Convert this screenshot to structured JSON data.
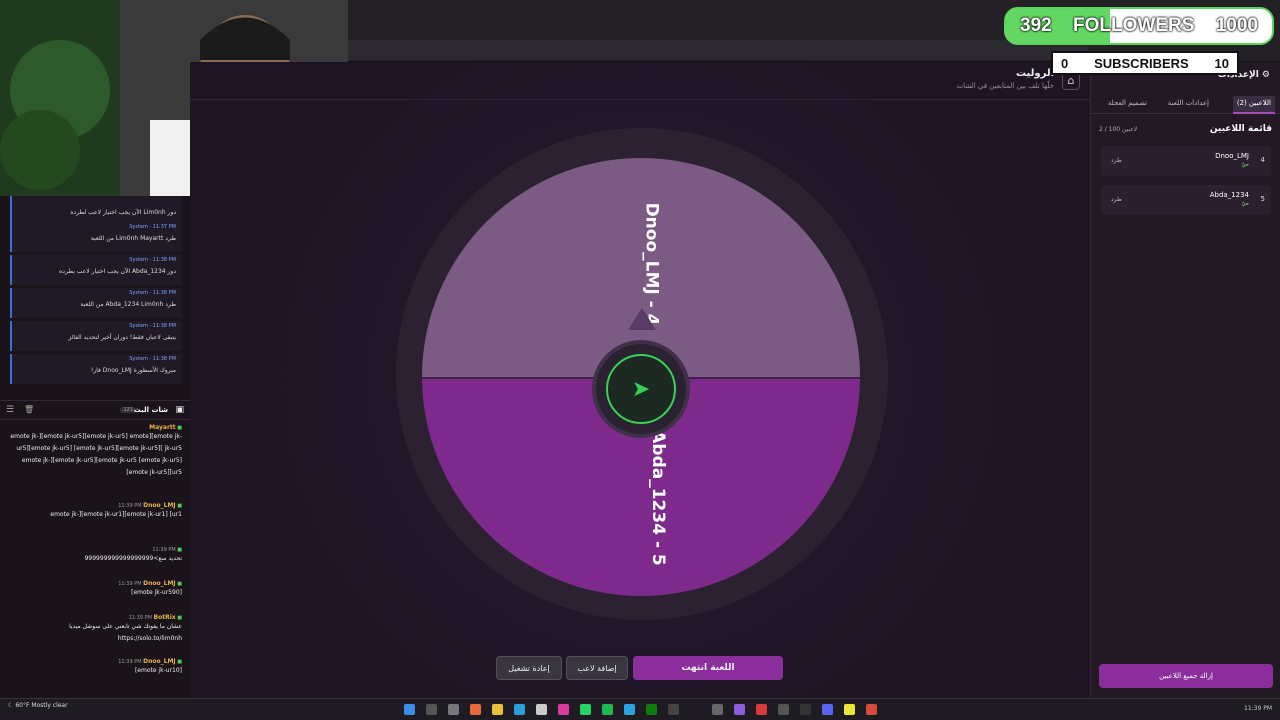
{
  "overlay": {
    "followers": {
      "current": "392",
      "label": "FOLLOWERS",
      "goal": "1000",
      "progress": 0.392,
      "color": "#63d763"
    },
    "subscribers": {
      "current": "0",
      "label": "SUBSCRIBERS",
      "goal": "10"
    }
  },
  "header": {
    "title": "الروليت",
    "subtitle": "خلّها تلف بين المتابعين في الشات"
  },
  "wheel": {
    "segments": [
      {
        "label": "Dnoo_LMJ - 4",
        "color": "#7b5a84"
      },
      {
        "label": "Abda_1234 - 5",
        "color": "#7d2a8c"
      }
    ]
  },
  "buttons": {
    "reset": "إعادة تشغيل",
    "add_player": "إضافة لاعب",
    "game_over": "اللعبة انتهت"
  },
  "right_panel": {
    "settings_title": "الإعدادات",
    "tabs": [
      "اللاعبين (2)",
      "إعدادات اللعبة",
      "تصميم العجلة"
    ],
    "list_title": "قائمة اللاعبين",
    "count": "2 / 100 لاعبين",
    "players": [
      {
        "num": "4",
        "name": "Dnoo_LMJ",
        "status": "حيّ",
        "kick": "طرد"
      },
      {
        "num": "5",
        "name": "Abda_1234",
        "status": "حيّ",
        "kick": "طرد"
      }
    ],
    "remove_all": "إزالة جميع اللاعبين"
  },
  "system_messages": [
    {
      "meta": "System · 11:37 PM",
      "text": "دور Lim0nh الآن يجب اختيار لاعب لطرده"
    },
    {
      "meta": "System · 11:37 PM",
      "text": "طرد Lim0nh Mayartt من اللعبة"
    },
    {
      "meta": "System · 11:38 PM",
      "text": "دور Abda_1234 الآن يجب اختيار لاعب بطرده"
    },
    {
      "meta": "System · 11:38 PM",
      "text": "طرد Abda_1234 Lim0nh من اللعبة"
    },
    {
      "meta": "System · 11:38 PM",
      "text": "يتبقى لاعبان فقط! دوران أخير لتحديد الفائز"
    },
    {
      "meta": "System · 11:38 PM",
      "text": "مبروك الأسطورة Dnoo_LMJ فاز!"
    }
  ],
  "chat": {
    "title": "شات البث",
    "count": "121",
    "messages": [
      {
        "user": "Mayartt",
        "time": "",
        "text": "emote jk-][emote jk-ur5][emote jk-ur5] emote][emote jk-ur5][emote jk-ur5] [emote jk-ur5][emote jk-ur5][ jk-ur5 emote jk-][emote jk-ur5][emote jk-ur5 [emote jk-ur5][emote jk-ur5][ur5"
      },
      {
        "user": "Dnoo_LMJ",
        "time": "11:39 PM",
        "text": "emote jk-][emote jk-ur1][emote jk-ur1] [ur1"
      },
      {
        "user": "",
        "time": "11:39 PM",
        "text": "تحديد سع>999999999999999999"
      },
      {
        "user": "Dnoo_LMJ",
        "time": "11:39 PM",
        "text": "[emote jk-ur590]"
      },
      {
        "user": "BotRix",
        "time": "11:39 PM",
        "text": "عشان ما يفوتك شي تابعني على سوشل ميديا https://solo.to/lim0nh"
      },
      {
        "user": "Dnoo_LMJ",
        "time": "11:39 PM",
        "text": "[emote jk-ur10]"
      }
    ]
  },
  "taskbar": {
    "weather_temp": "60°F",
    "weather_desc": "Mostly clear",
    "time": "11:39 PM"
  }
}
